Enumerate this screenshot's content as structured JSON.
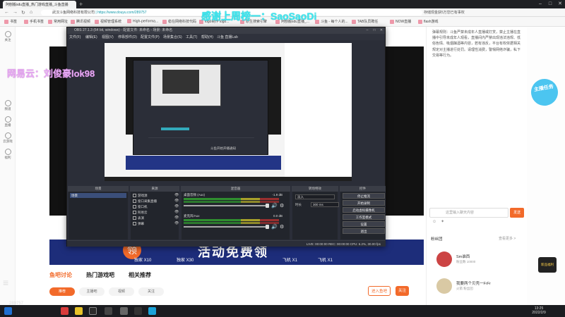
{
  "browser": {
    "tab_title": "阿刨搬sdu直播_热门游戏直播_斗鱼直播",
    "url_host": "武汉斗鱼网络科技有限公司",
    "url": "https://www.douyu.com/289757",
    "addr_right": "存储现金获5万您已有事权"
  },
  "bookmarks": [
    "书签",
    "手机书签",
    "常用网址",
    "腾讯视频",
    "视频管理系统",
    "High-performa...",
    "稳在网络科技代码",
    "logo制作 logo...",
    "原生搜索引擎",
    "阿刨搬sdu直播_...",
    "斗鱼 - 每个人的...",
    "TAB队员聘任",
    "NOW直播",
    "flash游戏"
  ],
  "left_nav": [
    {
      "icon": "follow-icon",
      "label": "关注"
    },
    {
      "icon": "tv-icon",
      "label": "频道"
    },
    {
      "icon": "star-icon",
      "label": "直播"
    },
    {
      "icon": "game-icon",
      "label": "云游戏"
    },
    {
      "icon": "gift-icon",
      "label": "福利"
    }
  ],
  "overlay": {
    "top_text": "感谢上周榜一：SaoSaoDi",
    "left_text": "网易云：刘俊豪lok98"
  },
  "obs": {
    "title": "OBS 27.1.3 (64 bit, windows) - 配置文件: 未命名 - 场景: 未命名",
    "menu": [
      "文件(F)",
      "编辑(E)",
      "视图(V)",
      "停靠部件(D)",
      "配置文件(P)",
      "场景集合(S)",
      "工具(T)",
      "帮助(H)",
      "斗鱼 直播Lab"
    ],
    "preview_caption": "斗鱼开始开播通知",
    "docks": {
      "scenes": {
        "title": "场景",
        "items": [
          "场景"
        ]
      },
      "sources": {
        "title": "来源",
        "items": [
          "游戏源",
          "窗口采集直播",
          "窗口机",
          "阿易云",
          "表演",
          "弹幕"
        ]
      },
      "mixer": {
        "title": "混音器",
        "rows": [
          {
            "name": "桌面音频 (Aux)",
            "db": "-1.9 dB"
          },
          {
            "name": "麦克风/Aux",
            "db": "0.0 dB"
          }
        ]
      },
      "transitions": {
        "title": "转场特效",
        "type_label": "淡入",
        "duration_label": "时长",
        "duration_value": "300 ms"
      },
      "controls": {
        "title": "控件",
        "buttons": [
          "停止推流",
          "开始录制",
          "启动虚拟摄像机",
          "工作室模式",
          "设置",
          "退出"
        ]
      }
    },
    "status": "LIVE: 00:00:00   REC: 00:00:00   CPU: 6.2%, 30.00 fps"
  },
  "page": {
    "banner_title": "活动免费领",
    "banner_items": [
      "独家 X10",
      "独家 X30",
      "飞机 X1",
      "飞机 X1"
    ],
    "tabs": [
      "鱼吧讨论",
      "热门游戏吧",
      "相关推荐"
    ],
    "pills": [
      "推荐",
      "主播吧",
      "视频",
      "关注"
    ],
    "join_btn": "进入鱼吧",
    "follow_btn": "关注",
    "room_counter": "289757"
  },
  "right_panel": {
    "rules": "弹幕规则：斗鱼严禁未成年人直播或打赏，禁止主播在直播中引导未成年人观看，直播间内严禁出现违法违规、低俗色情、吸烟酗酒等内容，若有违反，平台有权依据相关规定对主播进行处罚。请理性消费，警惕网络诈骗，私下交易等行为。",
    "input_placeholder": "这里输入聊天内容",
    "send": "发送",
    "fans_title": "粉丝团",
    "fans_more": "查看更多 >",
    "fans": [
      {
        "name": "Sm谁西",
        "sub": "粉丝数 10000"
      },
      {
        "name": "我要两个贝壳一FrFr",
        "sub": "火箭 粉丝团"
      }
    ],
    "promo_text": "主播任务",
    "corner_badge": "新品福利"
  },
  "taskbar": {
    "time": "13:25",
    "date": "2022/2/9"
  }
}
